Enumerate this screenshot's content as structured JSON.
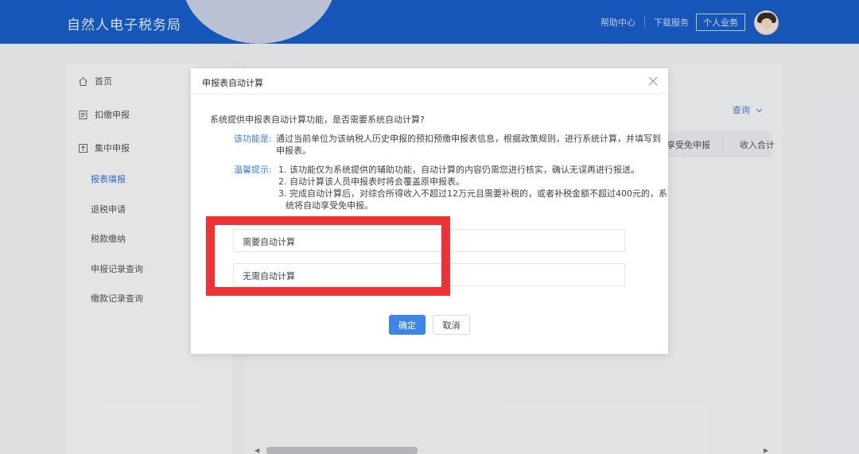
{
  "header": {
    "brand": "自然人电子税务局",
    "help": "帮助中心",
    "download": "下载服务",
    "personal": "个人业务"
  },
  "sidebar": {
    "items": [
      {
        "label": "首页",
        "icon": "home-icon"
      },
      {
        "label": "扣缴申报",
        "icon": "document-icon"
      },
      {
        "label": "集中申报",
        "icon": "upload-box-icon"
      }
    ],
    "subitems": [
      {
        "label": "报表填报",
        "active": true
      },
      {
        "label": "退税申请",
        "active": false
      },
      {
        "label": "税款缴纳",
        "active": false
      },
      {
        "label": "申报记录查询",
        "active": false
      },
      {
        "label": "缴款记录查询",
        "active": false
      }
    ]
  },
  "main": {
    "query": "查询",
    "table_headers": [
      "享受免申报",
      "收入合计"
    ]
  },
  "modal": {
    "title": "申报表自动计算",
    "question": "系统提供申报表自动计算功能，是否需要系统自动计算?",
    "function_label": "该功能是:",
    "function_lines": [
      "通过当前单位为该纳税人历史申报的预扣预缴申报表信息，根据政策规则，进行系统计算，并填写到",
      "申报表。"
    ],
    "tip_label": "温馨提示:",
    "tip_lines": [
      "1. 该功能仅为系统提供的辅助功能，自动计算的内容仍需您进行核实，确认无误再进行报送。",
      "2. 自动计算该人员申报表时将会覆盖原申报表。",
      "3. 完成自动计算后，对综合所得收入不超过12万元且需要补税的，或者补税金额不超过400元的，系",
      "统将自动享受免申报。"
    ],
    "options": [
      "需要自动计算",
      "无需自动计算"
    ],
    "confirm": "确定",
    "cancel": "取消"
  },
  "colors": {
    "header_blue": "#1a5ec9",
    "accent": "#3c86e6",
    "highlight_red": "#ef3233"
  }
}
